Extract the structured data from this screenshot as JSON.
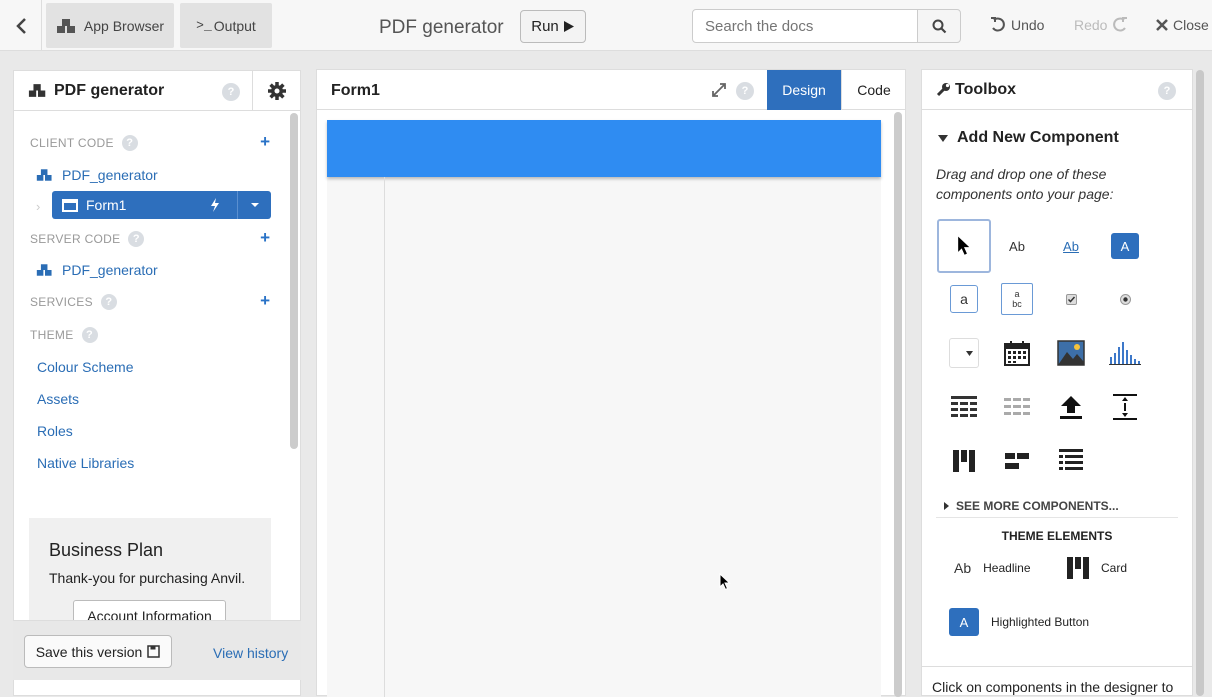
{
  "topbar": {
    "app_browser_label": "App Browser",
    "output_label": "Output",
    "app_title": "PDF generator",
    "run_label": "Run",
    "search_placeholder": "Search the docs",
    "undo_label": "Undo",
    "redo_label": "Redo",
    "close_label": "Close"
  },
  "left": {
    "title": "PDF generator",
    "client_code_label": "CLIENT CODE",
    "client_module": "PDF_generator",
    "form_label": "Form1",
    "server_code_label": "SERVER CODE",
    "server_module": "PDF_generator",
    "services_label": "SERVICES",
    "theme_label": "THEME",
    "theme_items": [
      "Colour Scheme",
      "Assets",
      "Roles",
      "Native Libraries"
    ],
    "business": {
      "title": "Business Plan",
      "text": "Thank-you for purchasing Anvil.",
      "button": "Account Information"
    },
    "save_label": "Save this version",
    "history_label": "View history"
  },
  "center": {
    "form_title": "Form1",
    "design_label": "Design",
    "code_label": "Code"
  },
  "toolbox": {
    "title": "Toolbox",
    "add_new": "Add New Component",
    "instructions": "Drag and drop one of these components onto your page:",
    "see_more": "SEE MORE COMPONENTS...",
    "theme_elements": "THEME ELEMENTS",
    "headline_label": "Headline",
    "card_label": "Card",
    "highlighted_button_label": "Highlighted Button",
    "footer_text": "Click on components in the designer to",
    "tool_texts": {
      "label": "Ab",
      "link": "Ab",
      "button": "A",
      "textbox": "a",
      "textarea": "a bc"
    }
  },
  "colors": {
    "accent": "#2e6fbd",
    "navbar": "#2f8cf2",
    "link": "#2a6db5"
  }
}
